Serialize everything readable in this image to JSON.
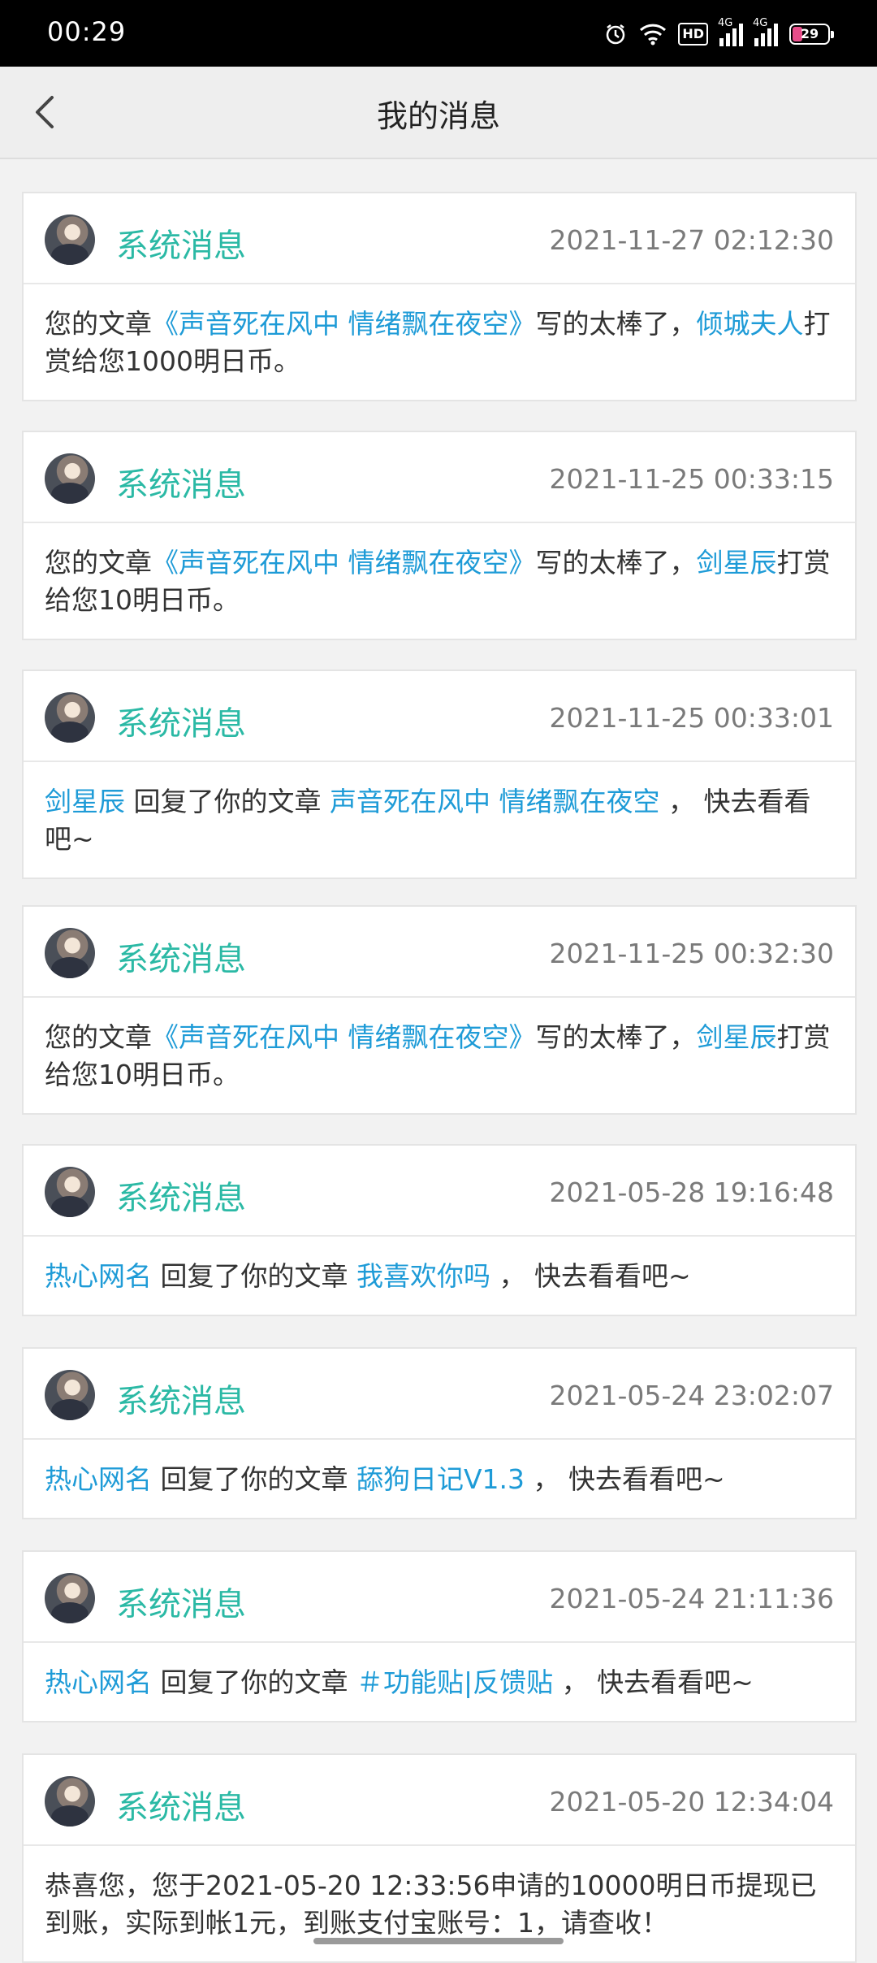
{
  "status_bar": {
    "time": "00:29",
    "battery_level": "29",
    "battery_fraction": 0.29,
    "network_tag": "4G",
    "hd_label": "HD"
  },
  "header": {
    "title": "我的消息"
  },
  "messages": [
    {
      "sender": "系统消息",
      "time": "2021-11-27 02:12:30",
      "parts": [
        {
          "text": "您的文章",
          "link": false
        },
        {
          "text": "《声音死在风中 情绪飘在夜空》",
          "link": true
        },
        {
          "text": "写的太棒了，",
          "link": false
        },
        {
          "text": "倾城夫人",
          "link": true
        },
        {
          "text": "打赏给您1000明日币。",
          "link": false
        }
      ]
    },
    {
      "sender": "系统消息",
      "time": "2021-11-25 00:33:15",
      "parts": [
        {
          "text": "您的文章",
          "link": false
        },
        {
          "text": "《声音死在风中 情绪飘在夜空》",
          "link": true
        },
        {
          "text": "写的太棒了，",
          "link": false
        },
        {
          "text": "剑星辰",
          "link": true
        },
        {
          "text": "打赏给您10明日币。",
          "link": false
        }
      ]
    },
    {
      "sender": "系统消息",
      "time": "2021-11-25 00:33:01",
      "parts": [
        {
          "text": "剑星辰",
          "link": true
        },
        {
          "text": " 回复了你的文章 ",
          "link": false
        },
        {
          "text": "声音死在风中 情绪飘在夜空",
          "link": true
        },
        {
          "text": " ， 快去看看吧~",
          "link": false
        }
      ]
    },
    {
      "sender": "系统消息",
      "time": "2021-11-25 00:32:30",
      "parts": [
        {
          "text": "您的文章",
          "link": false
        },
        {
          "text": "《声音死在风中 情绪飘在夜空》",
          "link": true
        },
        {
          "text": "写的太棒了，",
          "link": false
        },
        {
          "text": "剑星辰",
          "link": true
        },
        {
          "text": "打赏给您10明日币。",
          "link": false
        }
      ]
    },
    {
      "sender": "系统消息",
      "time": "2021-05-28 19:16:48",
      "parts": [
        {
          "text": "热心网名",
          "link": true
        },
        {
          "text": " 回复了你的文章 ",
          "link": false
        },
        {
          "text": "我喜欢你吗",
          "link": true
        },
        {
          "text": " ， 快去看看吧~",
          "link": false
        }
      ]
    },
    {
      "sender": "系统消息",
      "time": "2021-05-24 23:02:07",
      "parts": [
        {
          "text": "热心网名",
          "link": true
        },
        {
          "text": " 回复了你的文章 ",
          "link": false
        },
        {
          "text": "舔狗日记V1.3",
          "link": true
        },
        {
          "text": " ， 快去看看吧~",
          "link": false
        }
      ]
    },
    {
      "sender": "系统消息",
      "time": "2021-05-24 21:11:36",
      "parts": [
        {
          "text": "热心网名",
          "link": true
        },
        {
          "text": " 回复了你的文章 ",
          "link": false
        },
        {
          "text": "＃功能贴|反馈贴",
          "link": true
        },
        {
          "text": " ， 快去看看吧~",
          "link": false
        }
      ]
    },
    {
      "sender": "系统消息",
      "time": "2021-05-20 12:34:04",
      "parts": [
        {
          "text": "恭喜您，您于2021-05-20 12:33:56申请的10000明日币提现已到账，实际到帐1元，到账支付宝账号：1，请查收！",
          "link": false
        }
      ]
    }
  ],
  "colors": {
    "sender": "#2bb9a5",
    "link": "#1e9bd7",
    "text": "#333333",
    "time": "#7a7a7a"
  }
}
